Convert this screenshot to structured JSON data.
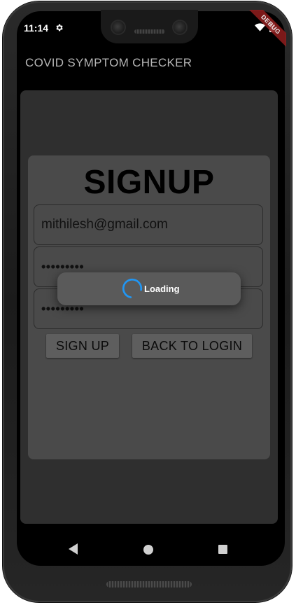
{
  "status_bar": {
    "time": "11:14",
    "settings_icon": "gear-icon",
    "wifi_icon": "wifi-icon",
    "battery_icon": "battery-icon"
  },
  "debug_banner": "DEBUG",
  "app_bar": {
    "title": "COVID SYMPTOM CHECKER"
  },
  "signup_form": {
    "heading": "SIGNUP",
    "email_value": "mithilesh@gmail.com",
    "password_value": "•••••••••",
    "confirm_password_value": "•••••••••",
    "signup_button_label": "SIGN UP",
    "back_to_login_button_label": "BACK TO LOGIN"
  },
  "loading_dialog": {
    "text": "Loading",
    "spinner_color": "#2196f3"
  },
  "nav_bar": {
    "back_icon": "triangle-back-icon",
    "home_icon": "circle-home-icon",
    "recent_icon": "square-recents-icon"
  },
  "colors": {
    "background": "#000000",
    "outer_card": "#2f2f2f",
    "inner_card": "#4a4a4a",
    "button": "#5e5e5e",
    "app_title": "#b5b5b5"
  }
}
